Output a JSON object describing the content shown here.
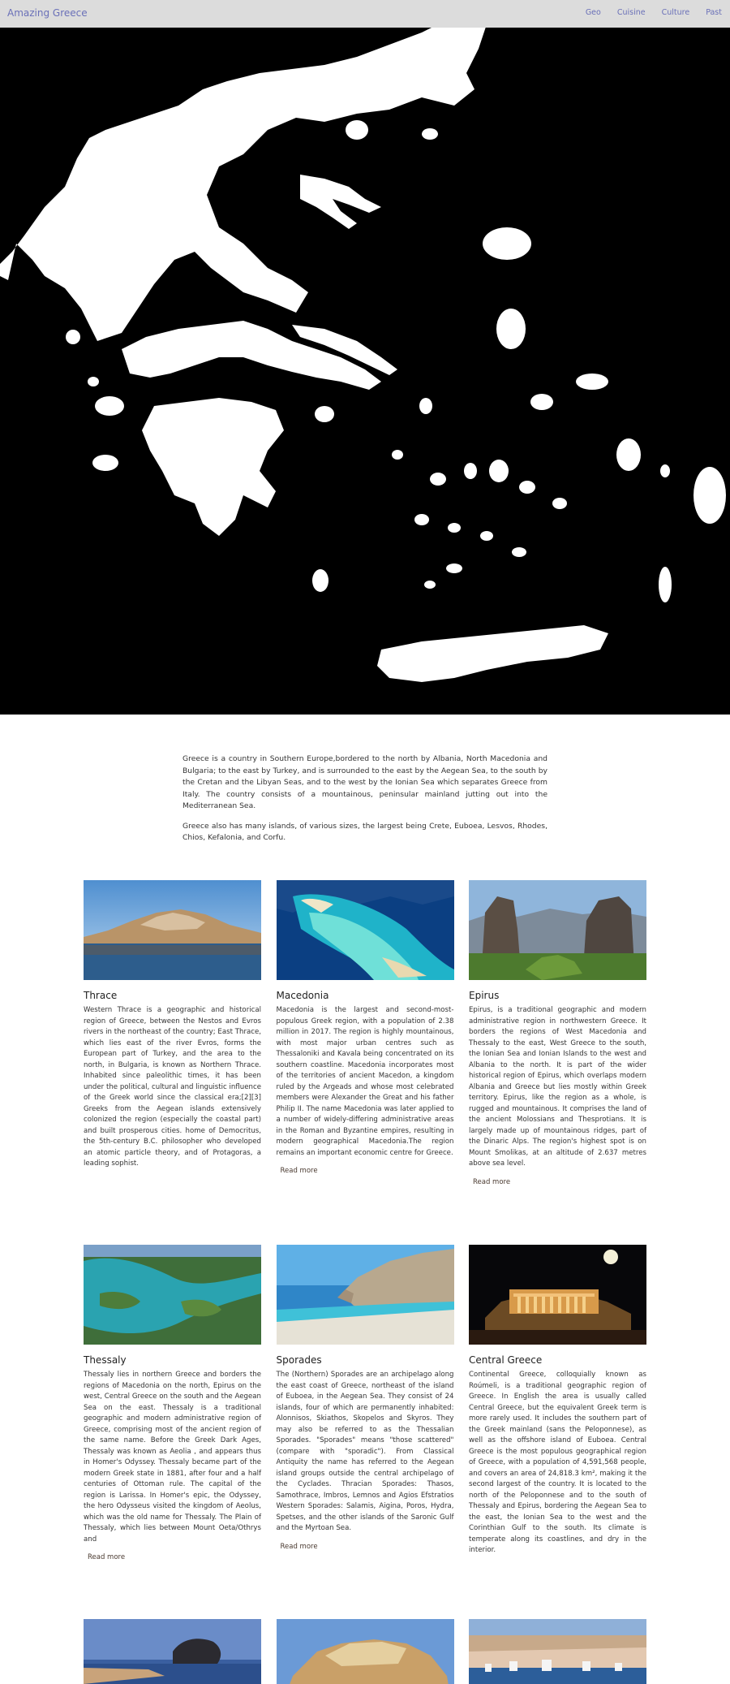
{
  "navbar": {
    "brand": "Amazing Greece",
    "links": [
      "Geo",
      "Cuisine",
      "Culture",
      "Past"
    ]
  },
  "hero": {
    "image": "greece-map-silhouette",
    "background": "#000000",
    "land_color": "#ffffff"
  },
  "intro": {
    "paragraphs": [
      "Greece is a country in Southern Europe,bordered to the north by Albania, North Macedonia and Bulgaria; to the east by Turkey, and is surrounded to the east by the Aegean Sea, to the south by the Cretan and the Libyan Seas, and to the west by the Ionian Sea which separates Greece from Italy. The country consists of a mountainous, peninsular mainland jutting out into the Mediterranean Sea.",
      "Greece also has many islands, of various sizes, the largest being Crete, Euboea, Lesvos, Rhodes, Chios, Kefalonia, and Corfu."
    ]
  },
  "cards": [
    {
      "title": "Thrace",
      "image": "thrace-coastal-town-photo",
      "text": "Western Thrace is a geographic and historical region of Greece, between the Nestos and Evros rivers in the northeast of the country; East Thrace, which lies east of the river Evros, forms the European part of Turkey, and the area to the north, in Bulgaria, is known as Northern Thrace. Inhabited since paleolithic times, it has been under the political, cultural and linguistic influence of the Greek world since the classical era;[2][3] Greeks from the Aegean islands extensively colonized the region (especially the coastal part) and built prosperous cities. home of Democritus, the 5th-century B.C. philosopher who developed an atomic particle theory, and of Protagoras, a leading sophist.",
      "read_more": null
    },
    {
      "title": "Macedonia",
      "image": "macedonia-turquoise-coast-photo",
      "text": "Macedonia is the largest and second-most-populous Greek region, with a population of 2.38 million in 2017. The region is highly mountainous, with most major urban centres such as Thessaloniki and Kavala being concentrated on its southern coastline. Macedonia incorporates most of the territories of ancient Macedon, a kingdom ruled by the Argeads and whose most celebrated members were Alexander the Great and his father Philip II. The name Macedonia was later applied to a number of widely-differing administrative areas in the Roman and Byzantine empires, resulting in modern geographical Macedonia.The region remains an important economic centre for Greece.",
      "read_more": "Read more"
    },
    {
      "title": "Epirus",
      "image": "epirus-rock-pillars-photo",
      "text": "Epirus, is a traditional geographic and modern administrative region in northwestern Greece. It borders the regions of West Macedonia and Thessaly to the east, West Greece to the south, the Ionian Sea and Ionian Islands to the west and Albania to the north. It is part of the wider historical region of Epirus, which overlaps modern Albania and Greece but lies mostly within Greek territory. Epirus, like the region as a whole, is rugged and mountainous. It comprises the land of the ancient Molossians and Thesprotians. It is largely made up of mountainous ridges, part of the Dinaric Alps. The region's highest spot is on Mount Smolikas, at an altitude of 2.637 metres above sea level.",
      "read_more": "Read more"
    },
    {
      "title": "Thessaly",
      "image": "thessaly-lake-aerial-photo",
      "text": "Thessaly lies in northern Greece and borders the regions of Macedonia on the north, Epirus on the west, Central Greece on the south and the Aegean Sea on the east. Thessaly is a traditional geographic and modern administrative region of Greece, comprising most of the ancient region of the same name. Before the Greek Dark Ages, Thessaly was known as Aeolia , and appears thus in Homer's Odyssey. Thessaly became part of the modern Greek state in 1881, after four and a half centuries of Ottoman rule. The capital of the region is Larissa. In Homer's epic, the Odyssey, the hero Odysseus visited the kingdom of Aeolus, which was the old name for Thessaly. The Plain of Thessaly, which lies between Mount Oeta/Othrys and",
      "read_more": "Read more"
    },
    {
      "title": "Sporades",
      "image": "sporades-beach-arch-photo",
      "text": "The (Northern) Sporades are an archipelago along the east coast of Greece, northeast of the island of Euboea, in the Aegean Sea. They consist of 24 islands, four of which are permanently inhabited: Alonnisos, Skiathos, Skopelos and Skyros. They may also be referred to as the Thessalian Sporades. \"Sporades\" means \"those scattered\" (compare with \"sporadic\"). From Classical Antiquity the name has referred to the Aegean island groups outside the central archipelago of the Cyclades. Thracian Sporades: Thasos, Samothrace, Imbros, Lemnos and Agios Efstratios Western Sporades: Salamis, Aigina, Poros, Hydra, Spetses, and the other islands of the Saronic Gulf and the Myrtoan Sea.",
      "read_more": "Read more"
    },
    {
      "title": "Central Greece",
      "image": "central-greece-acropolis-night-photo",
      "text": "Continental Greece, colloquially known as Roúmeli, is a traditional geographic region of Greece. In English the area is usually called Central Greece, but the equivalent Greek term is more rarely used. It includes the southern part of the Greek mainland (sans the Peloponnese), as well as the offshore island of Euboea. Central Greece is the most populous geographical region of Greece, with a population of 4,591,568 people, and covers an area of 24,818.3 km², making it the second largest of the country. It is located to the north of the Peloponnese and to the south of Thessaly and Epirus, bordering the Aegean Sea to the east, the Ionian Sea to the west and the Corinthian Gulf to the south. Its climate is temperate along its coastlines, and dry in the interior.",
      "read_more": null
    }
  ]
}
